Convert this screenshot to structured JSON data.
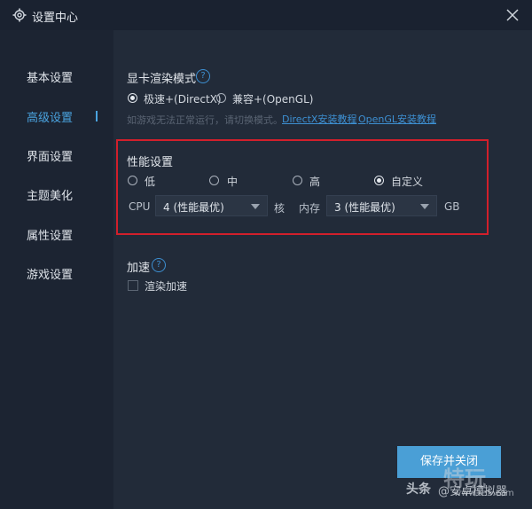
{
  "window": {
    "title": "设置中心"
  },
  "sidebar": {
    "items": [
      {
        "label": "基本设置"
      },
      {
        "label": "高级设置"
      },
      {
        "label": "界面设置"
      },
      {
        "label": "主题美化"
      },
      {
        "label": "属性设置"
      },
      {
        "label": "游戏设置"
      }
    ],
    "active_index": 1
  },
  "render_mode": {
    "title": "显卡渲染模式",
    "help": "?",
    "options": [
      {
        "label": "极速+(DirectX)",
        "checked": true
      },
      {
        "label": "兼容+(OpenGL)",
        "checked": false
      }
    ],
    "hint": "如游戏无法正常运行，请切换模式。",
    "link_directx": "DirectX安装教程",
    "link_opengl": "OpenGL安装教程"
  },
  "performance": {
    "title": "性能设置",
    "options": [
      {
        "label": "低",
        "checked": false
      },
      {
        "label": "中",
        "checked": false
      },
      {
        "label": "高",
        "checked": false
      },
      {
        "label": "自定义",
        "checked": true
      }
    ],
    "cpu_label": "CPU",
    "cpu_value": "4 (性能最优)",
    "cpu_unit": "核",
    "mem_label": "内存",
    "mem_value": "3 (性能最优)",
    "mem_unit": "GB"
  },
  "acceleration": {
    "title": "加速",
    "help": "?",
    "checkbox_label": "渲染加速",
    "checked": false
  },
  "footer": {
    "save_label": "保存并关闭"
  },
  "watermark": {
    "toutiao": "头条",
    "handle": "@安卓模拟器",
    "site_big": "特玩",
    "site_url": "www.te5.com"
  },
  "colors": {
    "accent": "#4a9fd6",
    "highlight_border": "#d21f2b",
    "background": "#222b39"
  }
}
